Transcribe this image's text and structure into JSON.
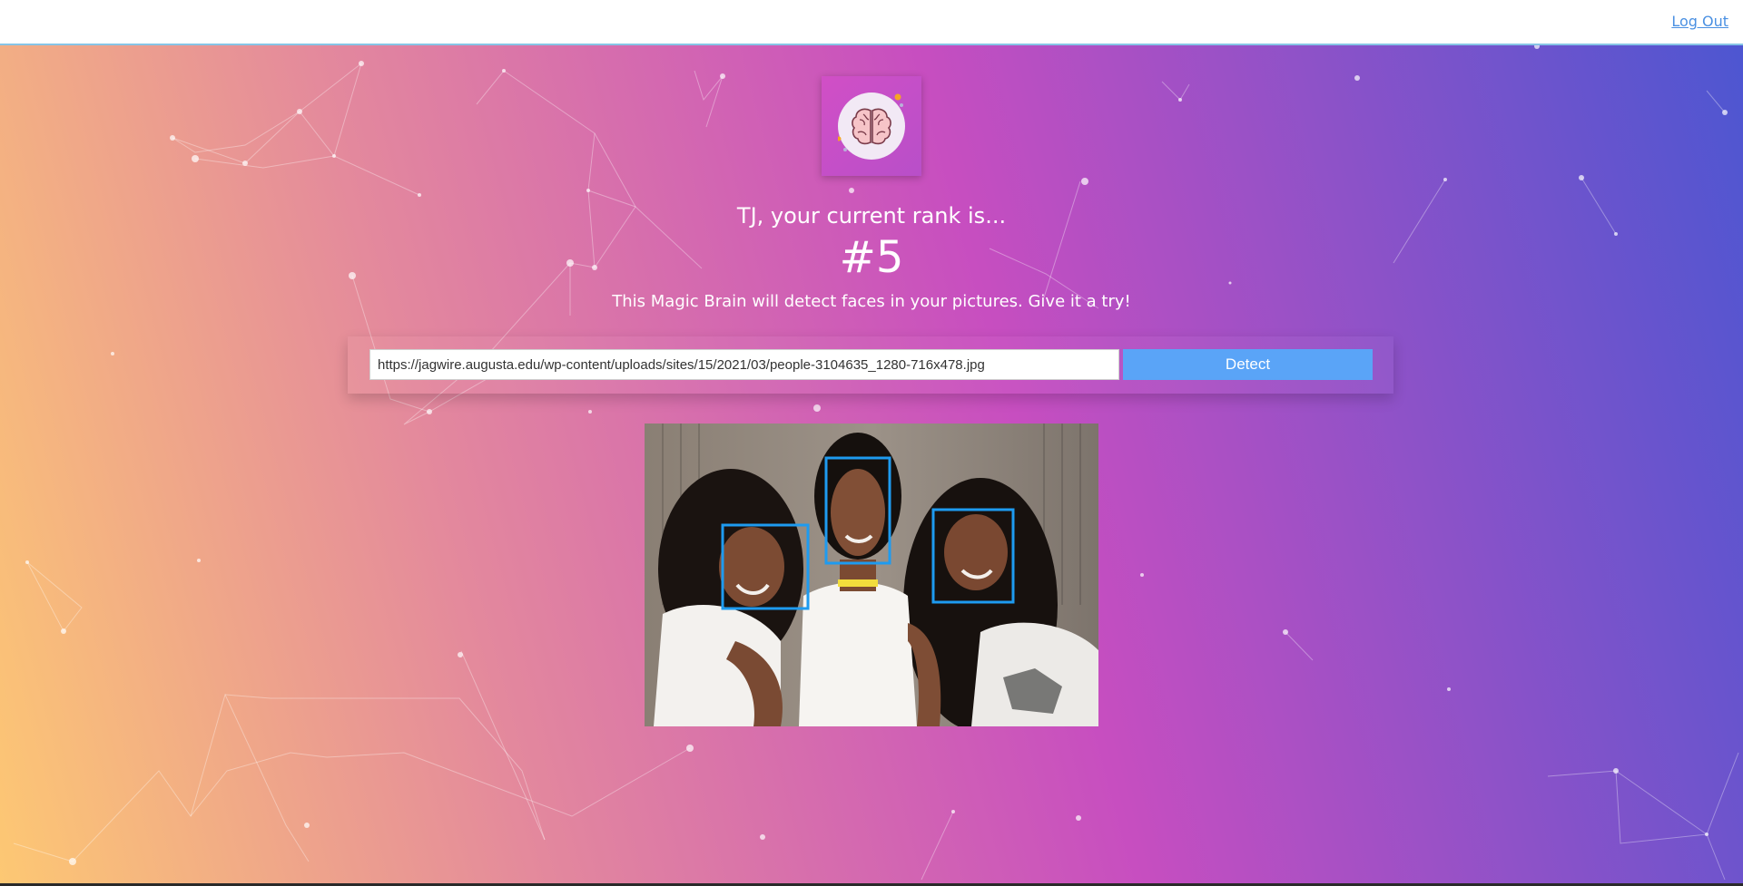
{
  "nav": {
    "logout_label": "Log Out"
  },
  "user": {
    "rank_message": "TJ, your current rank is...",
    "rank": "#5"
  },
  "intro_text": "This Magic Brain will detect faces in your pictures. Give it a try!",
  "form": {
    "url_value": "https://jagwire.augusta.edu/wp-content/uploads/sites/15/2021/03/people-3104635_1280-716x478.jpg",
    "detect_label": "Detect"
  },
  "logo": {
    "icon": "brain-icon"
  },
  "detection": {
    "face_count": 3
  },
  "colors": {
    "gradient": [
      "#fdc873",
      "#e3889d",
      "#c74ec0",
      "#4d56d1"
    ],
    "accent_button": "#5aa4f7",
    "face_box": "#1e9bf0",
    "link": "#4a90e2"
  }
}
